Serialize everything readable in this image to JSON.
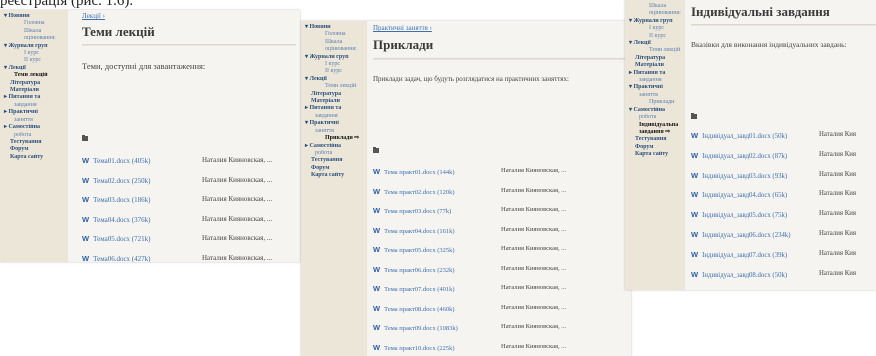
{
  "caption": "реєстрація (рис. 1.6).",
  "panel1": {
    "sidebar": [
      {
        "label": "▾ Новини",
        "level": 0
      },
      {
        "label": "Головна",
        "level": 2
      },
      {
        "label": "Шкала",
        "level": 2
      },
      {
        "label": "оцінювання:",
        "level": 2
      },
      {
        "label": "▾ Журнали груп",
        "level": 0
      },
      {
        "label": "І курс",
        "level": 2
      },
      {
        "label": "ІІ курс",
        "level": 2
      },
      {
        "label": "▾ Лекції",
        "level": 0
      },
      {
        "label": "Теми лекцій",
        "level": 1,
        "active": true
      },
      {
        "label": "Література",
        "level": 0,
        "plain": true
      },
      {
        "label": "Матеріали",
        "level": 0,
        "plain": true
      },
      {
        "label": "▸ Питання та",
        "level": 0
      },
      {
        "label": "завдання",
        "level": 1
      },
      {
        "label": "▸ Практичні",
        "level": 0
      },
      {
        "label": "заняття",
        "level": 1
      },
      {
        "label": "▸ Самостійна",
        "level": 0
      },
      {
        "label": "робота",
        "level": 1
      },
      {
        "label": "Тестування",
        "level": 0,
        "plain": true
      },
      {
        "label": "Форум",
        "level": 0,
        "plain": true
      },
      {
        "label": "Карта сайту",
        "level": 0,
        "plain": true
      }
    ],
    "breadcrumb": "Лекції ›",
    "title": "Теми лекцій",
    "intro": "Теми, доступні для завантаження:",
    "files": [
      {
        "name": "Тема01.docx (405k)",
        "author": "Наталия Кияновская, ..."
      },
      {
        "name": "Тема02.docx (250k)",
        "author": "Наталия Кияновская, ..."
      },
      {
        "name": "Тема03.docx (186k)",
        "author": "Наталия Кияновская, ..."
      },
      {
        "name": "Тема04.docx (376k)",
        "author": "Наталия Кияновская, ..."
      },
      {
        "name": "Тема05.docx (721k)",
        "author": "Наталия Кияновская, ..."
      },
      {
        "name": "Тема06.docx (427k)",
        "author": "Наталия Кияновская, ..."
      }
    ]
  },
  "panel2": {
    "sidebar": [
      {
        "label": "▾ Новини",
        "level": 0
      },
      {
        "label": "Головна",
        "level": 2
      },
      {
        "label": "Шкала",
        "level": 2
      },
      {
        "label": "оцінювання:",
        "level": 2
      },
      {
        "label": "▾ Журнали груп",
        "level": 0
      },
      {
        "label": "І курс",
        "level": 2
      },
      {
        "label": "ІІ курс",
        "level": 2
      },
      {
        "label": "▾ Лекції",
        "level": 0
      },
      {
        "label": "Теми лекцій",
        "level": 2
      },
      {
        "label": "Література",
        "level": 0,
        "plain": true
      },
      {
        "label": "Матеріали",
        "level": 0,
        "plain": true
      },
      {
        "label": "▸ Питання та",
        "level": 0
      },
      {
        "label": "завдання",
        "level": 1
      },
      {
        "label": "▾ Практичні",
        "level": 0
      },
      {
        "label": "заняття",
        "level": 1
      },
      {
        "label": "Приклади ⇨",
        "level": 2,
        "active": true
      },
      {
        "label": "▸ Самостійна",
        "level": 0
      },
      {
        "label": "робота",
        "level": 1
      },
      {
        "label": "Тестування",
        "level": 0,
        "plain": true
      },
      {
        "label": "Форум",
        "level": 0,
        "plain": true
      },
      {
        "label": "Карта сайту",
        "level": 0,
        "plain": true
      }
    ],
    "breadcrumb": "Практичні заняття ›",
    "title": "Приклади",
    "intro": "Приклади задач, що будуть розглядатися на практичних заняттях:",
    "files": [
      {
        "name": "Тема практ01.docx (144k)",
        "author": "Наталия Кияновская, ..."
      },
      {
        "name": "Тема практ02.docx (120k)",
        "author": "Наталия Кияновская, ..."
      },
      {
        "name": "Тема практ03.docx (77k)",
        "author": "Наталия Кияновская, ..."
      },
      {
        "name": "Тема практ04.docx (161k)",
        "author": "Наталия Кияновская, ..."
      },
      {
        "name": "Тема практ05.docx (325k)",
        "author": "Наталия Кияновская, ..."
      },
      {
        "name": "Тема практ06.docx (232k)",
        "author": "Наталия Кияновская, ..."
      },
      {
        "name": "Тема практ07.docx (401k)",
        "author": "Наталия Кияновская, ..."
      },
      {
        "name": "Тема практ08.docx (460k)",
        "author": "Наталия Кияновская, ..."
      },
      {
        "name": "Тема практ09.docx (1083k)",
        "author": "Наталия Кияновская, ..."
      },
      {
        "name": "Тема практ10.docx (225k)",
        "author": "Наталия Кияновская, ..."
      }
    ]
  },
  "panel3": {
    "sidebar": [
      {
        "label": "Шкала",
        "level": 2
      },
      {
        "label": "оцінювання:",
        "level": 2
      },
      {
        "label": "▾ Журнали груп",
        "level": 0
      },
      {
        "label": "І курс",
        "level": 2
      },
      {
        "label": "ІІ курс",
        "level": 2
      },
      {
        "label": "▾ Лекції",
        "level": 0
      },
      {
        "label": "Теми лекцій",
        "level": 2
      },
      {
        "label": "Література",
        "level": 0,
        "plain": true
      },
      {
        "label": "Матеріали",
        "level": 0,
        "plain": true
      },
      {
        "label": "▸ Питання та",
        "level": 0
      },
      {
        "label": "завдання",
        "level": 1
      },
      {
        "label": "▾ Практичні",
        "level": 0
      },
      {
        "label": "заняття",
        "level": 1
      },
      {
        "label": "Приклади",
        "level": 2
      },
      {
        "label": "▾ Самостійна",
        "level": 0
      },
      {
        "label": "робота",
        "level": 1
      },
      {
        "label": "Індивідуальна",
        "level": 1,
        "active": true
      },
      {
        "label": "завдання ⇨",
        "level": 1,
        "active": true
      },
      {
        "label": "Тестування",
        "level": 0,
        "plain": true
      },
      {
        "label": "Форум",
        "level": 0,
        "plain": true
      },
      {
        "label": "Карта сайту",
        "level": 0,
        "plain": true
      }
    ],
    "title": "Індивідуальні завдання",
    "intro": "Вказівки для виконання індивідуальних завдань:",
    "files": [
      {
        "name": "Індивідуал_завд01.docx (50k)",
        "author": "Наталия Кия"
      },
      {
        "name": "Індивідуал_завд02.docx (87k)",
        "author": "Наталия Кия"
      },
      {
        "name": "Індивідуал_завд03.docx (93k)",
        "author": "Наталия Кия"
      },
      {
        "name": "Індивідуал_завд04.docx (65k)",
        "author": "Наталия Кия"
      },
      {
        "name": "Індивідуал_завд05.docx (75k)",
        "author": "Наталия Кия"
      },
      {
        "name": "Індивідуал_завд06.docx (234k)",
        "author": "Наталия Кия"
      },
      {
        "name": "Індивідуал_завд07.docx (39k)",
        "author": "Наталия Кия"
      },
      {
        "name": "Індивідуал_завд08.docx (50k)",
        "author": "Наталия Кия"
      }
    ]
  }
}
